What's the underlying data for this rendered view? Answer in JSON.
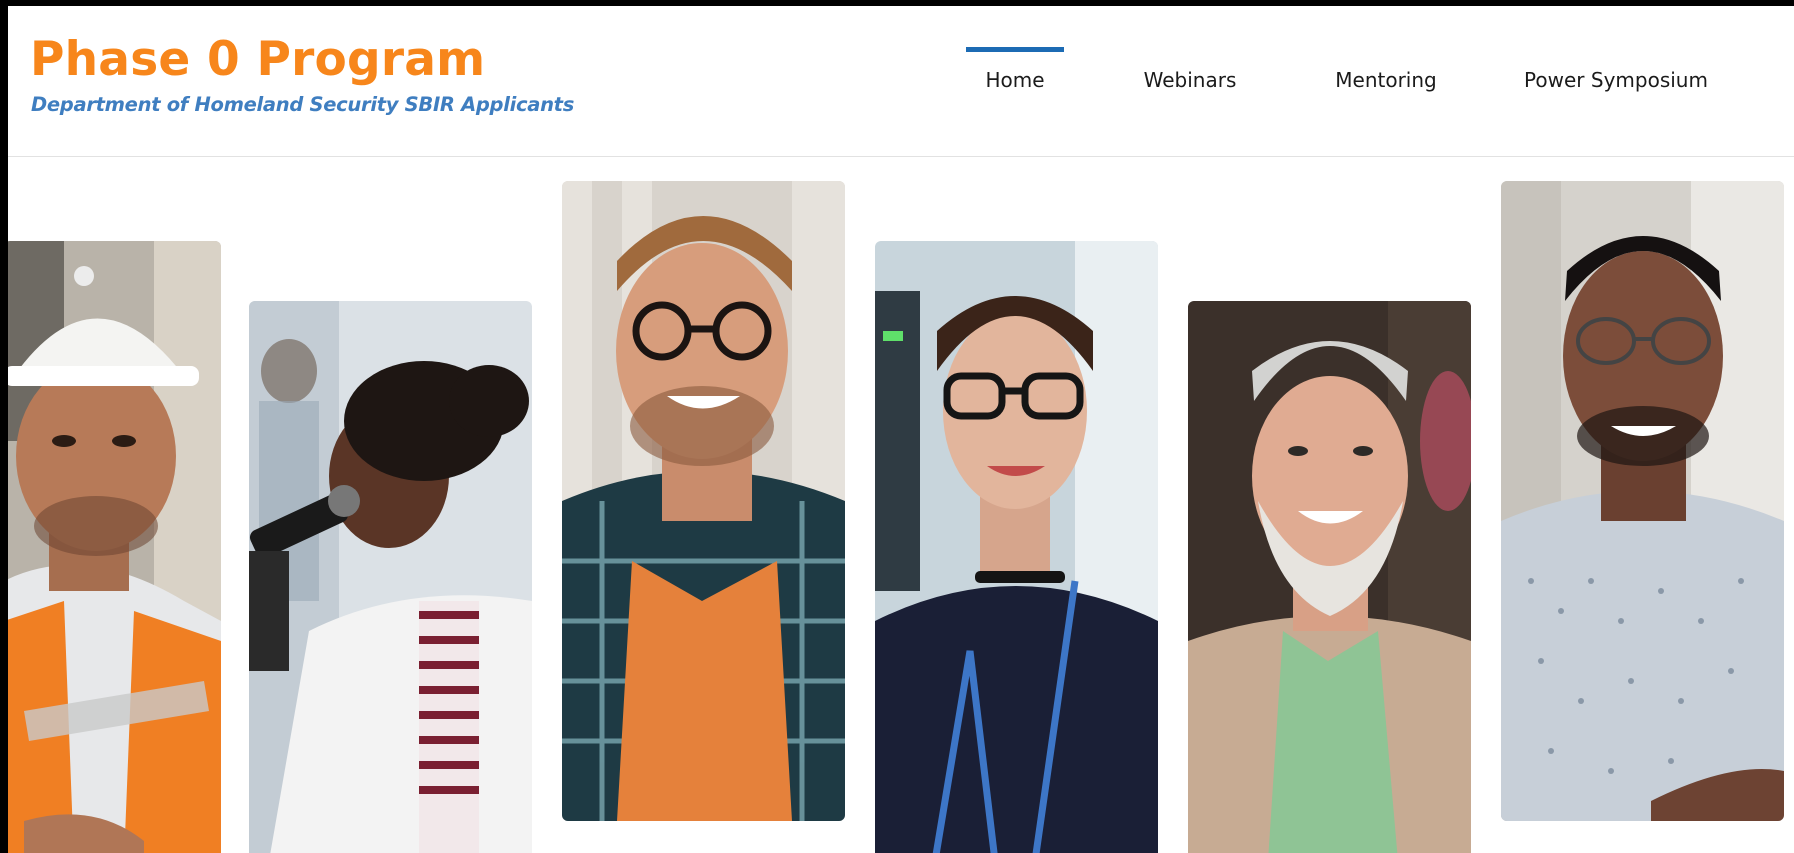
{
  "header": {
    "title": "Phase 0 Program",
    "subtitle": "Department of Homeland Security SBIR Applicants"
  },
  "nav": {
    "items": [
      {
        "label": "Home",
        "active": true
      },
      {
        "label": "Webinars",
        "active": false
      },
      {
        "label": "Mentoring",
        "active": false
      },
      {
        "label": "Power Symposium",
        "active": false
      }
    ]
  },
  "colors": {
    "brand_orange": "#f7861b",
    "subtitle_blue": "#3f7ec0",
    "nav_active": "#1c6bb4"
  },
  "gallery": {
    "photos": [
      {
        "subject": "construction-worker-photo"
      },
      {
        "subject": "scientist-microscope-photo"
      },
      {
        "subject": "man-plaid-shirt-photo"
      },
      {
        "subject": "woman-lanyard-photo"
      },
      {
        "subject": "older-man-beard-photo"
      },
      {
        "subject": "man-patterned-shirt-photo"
      }
    ]
  }
}
